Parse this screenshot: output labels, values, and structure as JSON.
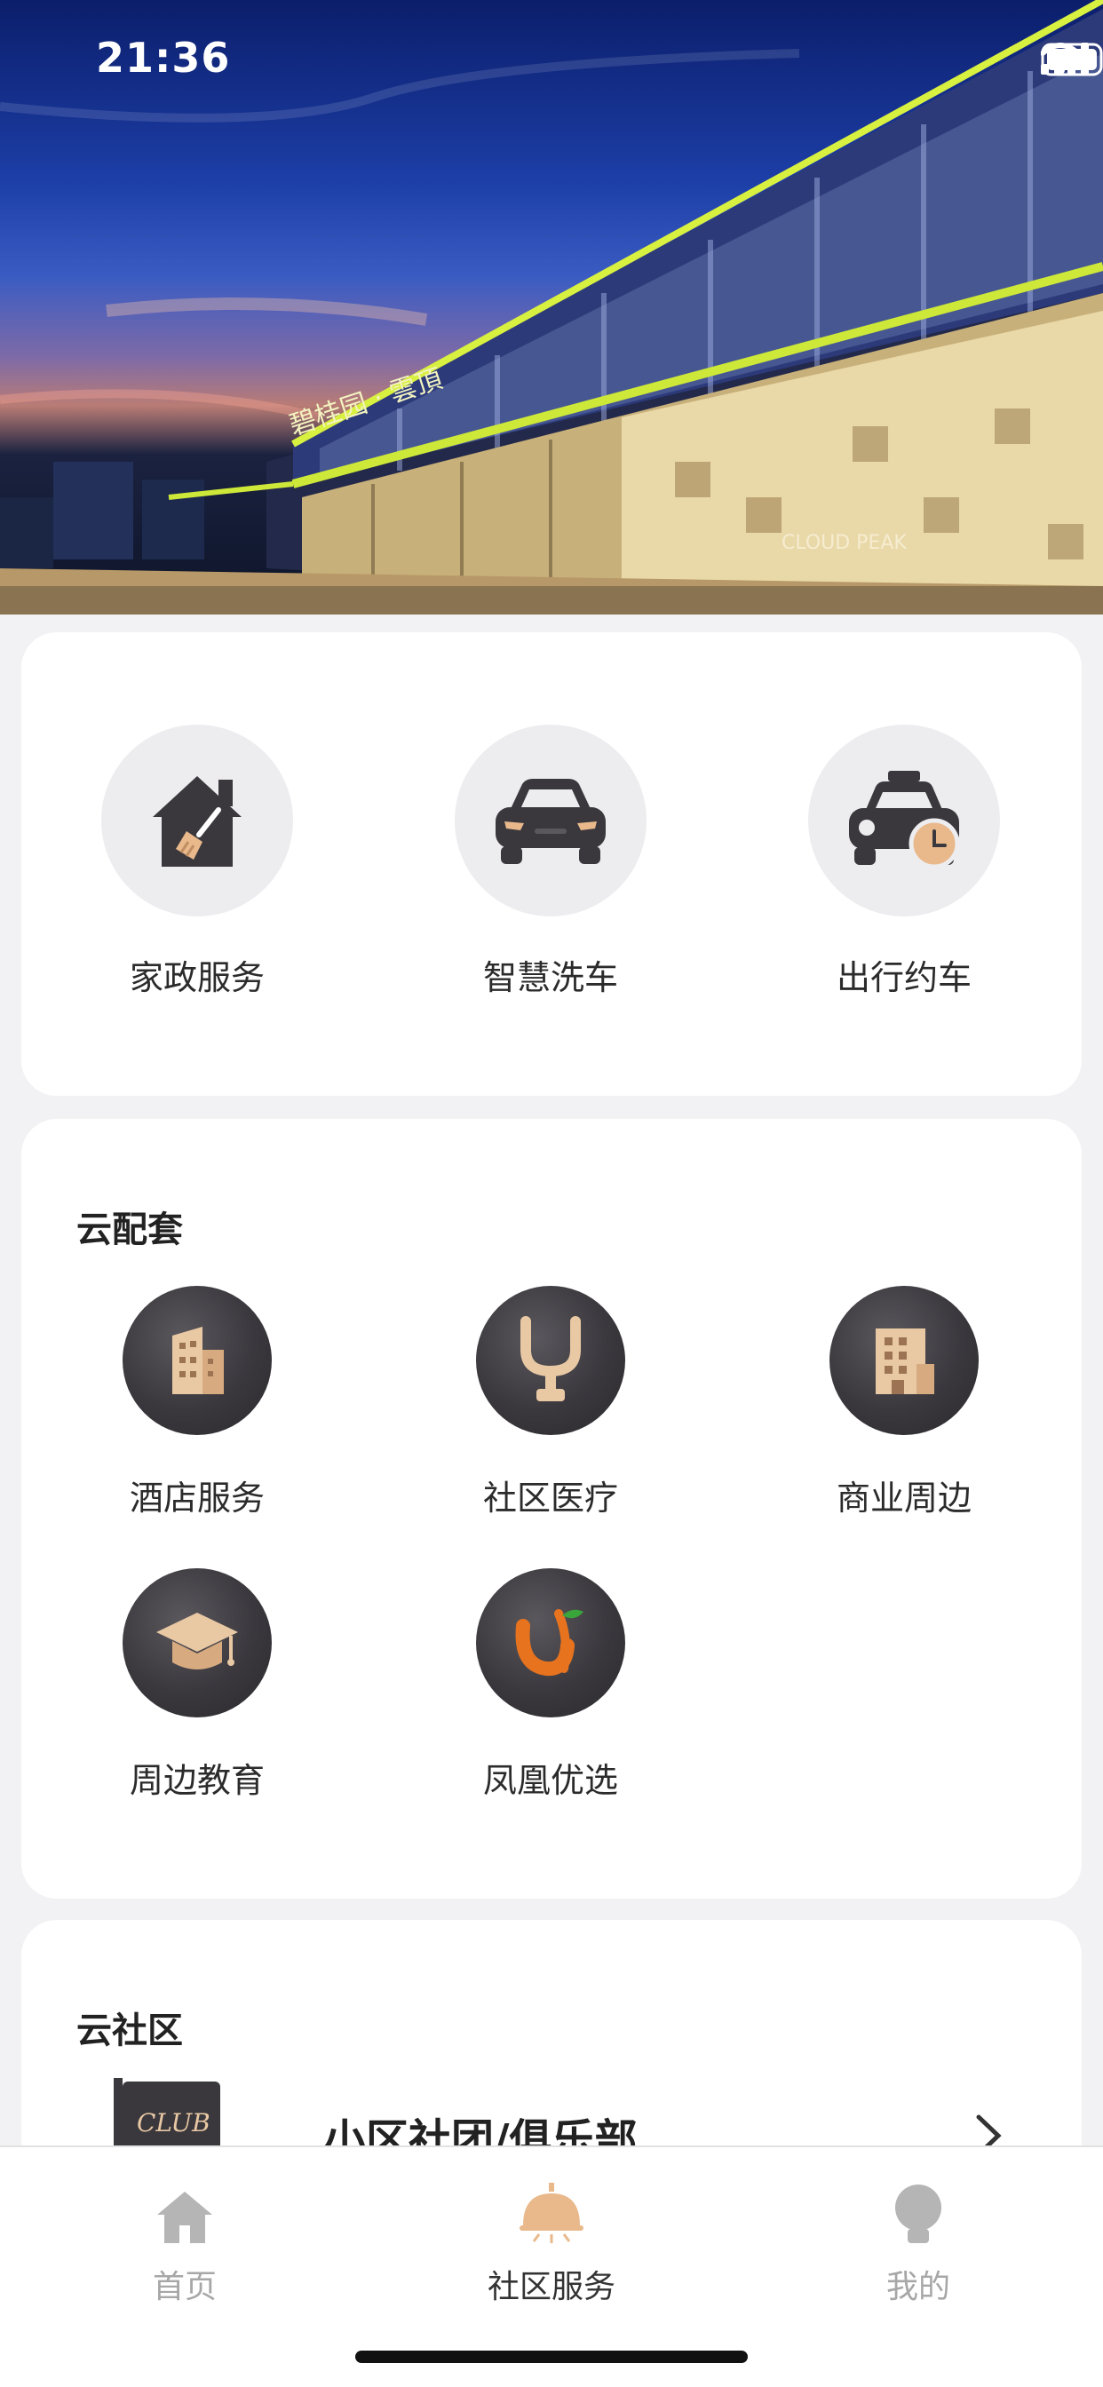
{
  "status_bar": {
    "time": "21:36"
  },
  "hero": {
    "building_sign": "碧桂园 · 雲頂",
    "facade_text": "CLOUD PEAK"
  },
  "top_services": [
    {
      "label": "家政服务",
      "icon": "house-broom-icon"
    },
    {
      "label": "智慧洗车",
      "icon": "car-icon"
    },
    {
      "label": "出行约车",
      "icon": "taxi-clock-icon"
    }
  ],
  "cloud_facilities": {
    "title": "云配套",
    "items": [
      {
        "label": "酒店服务",
        "icon": "hotel-building-icon"
      },
      {
        "label": "社区医疗",
        "icon": "stethoscope-icon"
      },
      {
        "label": "商业周边",
        "icon": "commercial-building-icon"
      },
      {
        "label": "周边教育",
        "icon": "graduation-cap-icon"
      },
      {
        "label": "凤凰优选",
        "icon": "phoenix-select-logo-icon"
      }
    ]
  },
  "cloud_community": {
    "title": "云社区",
    "rows": [
      {
        "label": "小区社团/俱乐部",
        "icon_text": "CLUB"
      }
    ]
  },
  "tab_bar": {
    "tabs": [
      {
        "label": "首页",
        "icon": "home-icon",
        "active": false
      },
      {
        "label": "社区服务",
        "icon": "community-bell-icon",
        "active": true
      },
      {
        "label": "我的",
        "icon": "profile-icon",
        "active": false
      }
    ]
  },
  "colors": {
    "accent_gold": "#e9b98c",
    "icon_dark": "#3a383d",
    "active_tab_text": "#333333",
    "inactive_tab_text": "#a7a7a7"
  }
}
